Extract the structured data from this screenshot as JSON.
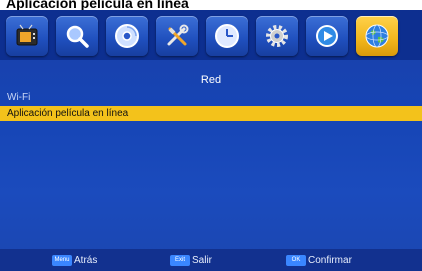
{
  "caption": "Aplicación película en línea",
  "icon_bar": {
    "icons": [
      {
        "name": "tv-icon",
        "selected": false
      },
      {
        "name": "search-icon",
        "selected": false
      },
      {
        "name": "disc-icon",
        "selected": false
      },
      {
        "name": "tools-icon",
        "selected": false
      },
      {
        "name": "clock-icon",
        "selected": false
      },
      {
        "name": "gear-icon",
        "selected": false
      },
      {
        "name": "play-icon",
        "selected": false
      },
      {
        "name": "globe-icon",
        "selected": true
      }
    ]
  },
  "menu": {
    "title": "Red",
    "items": [
      {
        "label": "Wi-Fi",
        "selected": false
      },
      {
        "label": "Aplicación película en línea",
        "selected": true
      }
    ]
  },
  "footer": {
    "back": {
      "key": "Menu",
      "label": "Atrás"
    },
    "exit": {
      "key": "Exit",
      "label": "Salir"
    },
    "confirm": {
      "key": "OK",
      "label": "Confirmar"
    }
  },
  "colors": {
    "background": "#1b46b0",
    "highlight": "#f3c21b",
    "selected_tile": "#f1b51c"
  }
}
